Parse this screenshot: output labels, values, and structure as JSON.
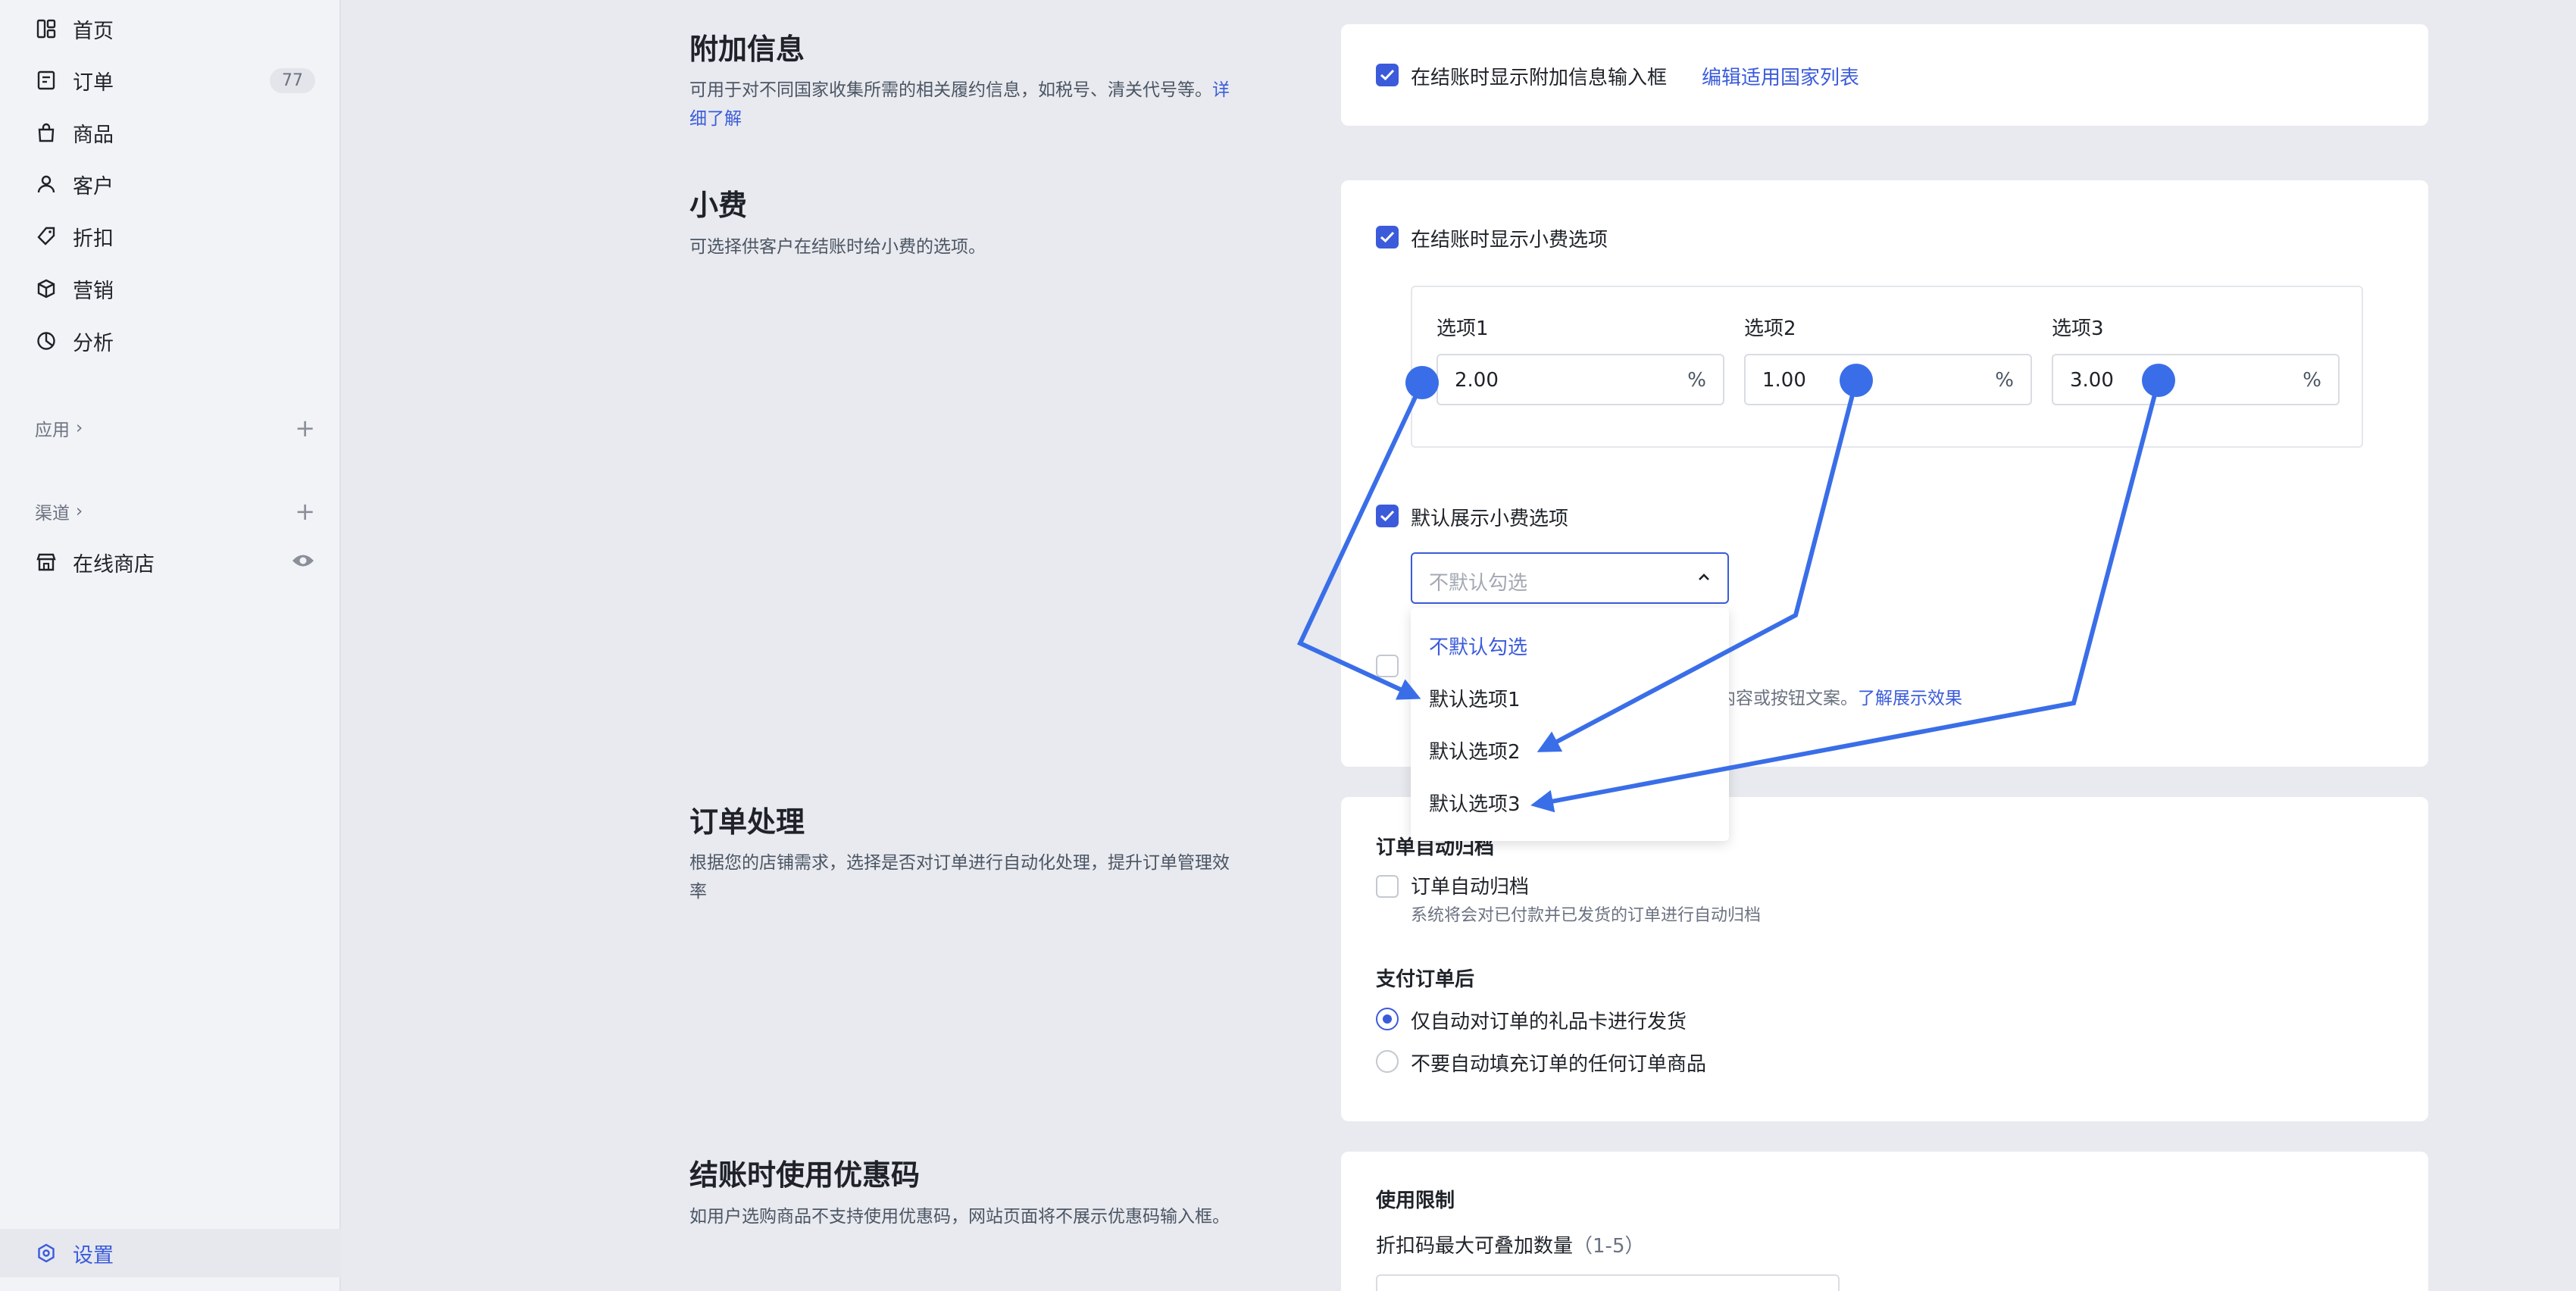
{
  "sidebar": {
    "nav": [
      {
        "label": "首页",
        "icon": "dashboard-icon"
      },
      {
        "label": "订单",
        "icon": "order-icon",
        "badge": "77"
      },
      {
        "label": "商品",
        "icon": "bag-icon"
      },
      {
        "label": "客户",
        "icon": "user-icon"
      },
      {
        "label": "折扣",
        "icon": "tag-icon"
      },
      {
        "label": "营销",
        "icon": "cube-icon"
      },
      {
        "label": "分析",
        "icon": "pie-icon"
      }
    ],
    "apps_label": "应用",
    "channels_label": "渠道",
    "online_store": "在线商店",
    "settings": "设置"
  },
  "extra_info": {
    "title": "附加信息",
    "desc": "可用于对不同国家收集所需的相关履约信息，如税号、清关代号等。",
    "desc_link": "详细了解",
    "checkbox_label": "在结账时显示附加信息输入框",
    "edit_link": "编辑适用国家列表"
  },
  "tips": {
    "title": "小费",
    "desc": "可选择供客户在结账时给小费的选项。",
    "show_label": "在结账时显示小费选项",
    "options": [
      {
        "label": "选项1",
        "value": "2.00",
        "unit": "%"
      },
      {
        "label": "选项2",
        "value": "1.00",
        "unit": "%"
      },
      {
        "label": "选项3",
        "value": "3.00",
        "unit": "%"
      }
    ],
    "default_label": "默认展示小费选项",
    "select_placeholder": "不默认勾选",
    "dropdown": [
      "不默认勾选",
      "默认选项1",
      "默认选项2",
      "默认选项3"
    ],
    "hidden_text_tail": "息、内容或按钮文案。",
    "hidden_link": "了解展示效果"
  },
  "order_processing": {
    "title": "订单处理",
    "desc": "根据您的店铺需求，选择是否对订单进行自动化处理，提升订单管理效率",
    "auto_archive_heading": "订单自动归档",
    "auto_archive_label": "订单自动归档",
    "auto_archive_desc": "系统将会对已付款并已发货的订单进行自动归档",
    "after_payment_heading": "支付订单后",
    "radio1": "仅自动对订单的礼品卡进行发货",
    "radio2": "不要自动填充订单的任何订单商品"
  },
  "coupon": {
    "title": "结账时使用优惠码",
    "desc": "如用户选购商品不支持使用优惠码，网站页面将不展示优惠码输入框。",
    "limit_heading": "使用限制",
    "stack_label": "折扣码最大可叠加数量",
    "stack_range": "（1-5）"
  },
  "colors": {
    "accent": "#3b5bdb",
    "annotation": "#3a6ee8"
  }
}
